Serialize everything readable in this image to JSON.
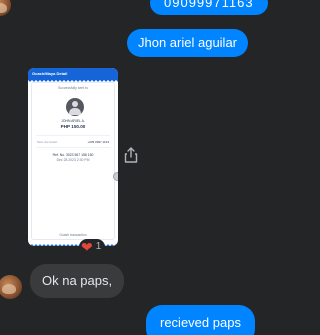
{
  "messages": {
    "top_partial": "09099971163",
    "name": "Jhon ariel aguilar",
    "reply": "Ok na paps,",
    "last": "recieved paps"
  },
  "receipt": {
    "header": "Gcash/Maya Detail",
    "title": "Successfully sent to",
    "recipient": "JOHN ARIEL A.",
    "amount": "PHP 150.00",
    "row1_left": "Sent via Gcash",
    "row1_right": "+639 0997 1163",
    "ref": "Ref. No. 3023 567 158 150",
    "date": "Dec 28 2023 2:30 PM",
    "footer": "Gcash transaction"
  },
  "reaction": {
    "emoji": "❤",
    "count": "1"
  },
  "colors": {
    "background": "#242526",
    "outgoing": "#0084ff",
    "incoming": "#3a3b3c",
    "receipt_accent": "#1565d8"
  },
  "icons": [
    "avatar",
    "share-icon",
    "heart-icon"
  ]
}
